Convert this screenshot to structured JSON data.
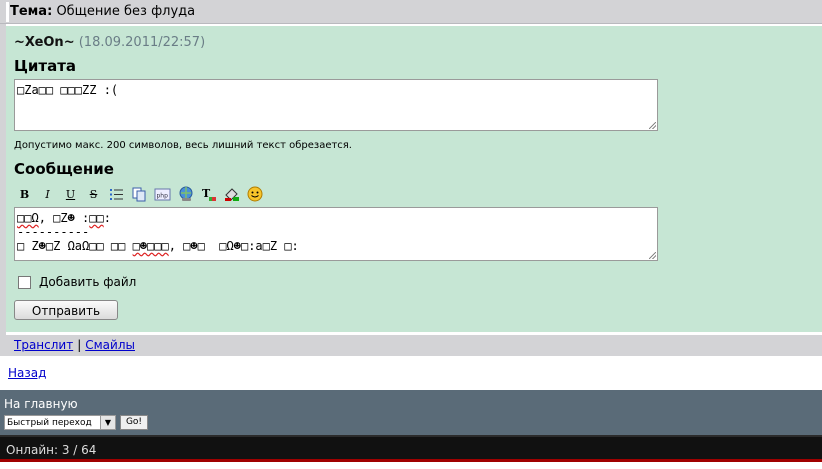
{
  "topic": {
    "label": "Тема:",
    "title": "Общение без флуда"
  },
  "author": {
    "nick": "~XeOn~",
    "date": "(18.09.2011/22:57)"
  },
  "quote": {
    "title": "Цитата",
    "text": "□Za□□ □□□ZZ :(",
    "hint": "Допустимо макс. 200 символов, весь лишний текст обрезается."
  },
  "message": {
    "title": "Сообщение",
    "line1_a": "□□Ω",
    "line1_b": ", □Z☻ :",
    "line1_c": "□□",
    "line1_d": ":",
    "line2": "----------",
    "line3_a": "□ Z☻□Z ΩaΩ□□ □□ ",
    "line3_b": "□☻□□□",
    "line3_c": ", □☻□  □Ω☻□:a□Z □:"
  },
  "toolbar": {
    "bold": "B",
    "italic": "I",
    "underline": "U",
    "strike": "S",
    "icons": [
      "list-icon",
      "copy-icon",
      "php-icon",
      "link-icon",
      "translit-icon",
      "color-icon",
      "smile-icon"
    ]
  },
  "attach": {
    "label": "Добавить файл",
    "checked": false
  },
  "send": {
    "label": "Отправить"
  },
  "links": {
    "translit": "Транслит",
    "separator": "|",
    "smiles": "Смайлы"
  },
  "back": {
    "label": "Назад"
  },
  "footer": {
    "home": "На главную",
    "quick_jump": "Быстрый переход",
    "go": "Go!",
    "online": "Онлайн: 3 / 64"
  }
}
